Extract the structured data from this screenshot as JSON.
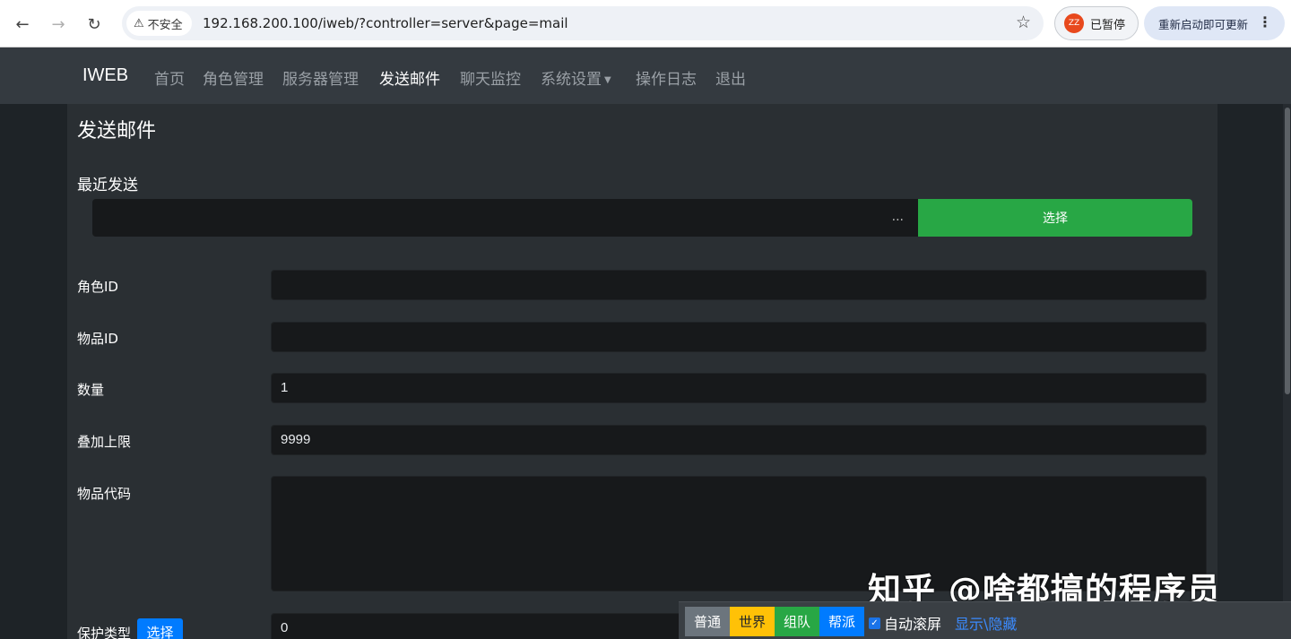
{
  "browser": {
    "security_label": "不安全",
    "url": "192.168.200.100/iweb/?controller=server&page=mail",
    "profile_initials": "ZZ",
    "profile_status": "已暂停",
    "update_label": "重新启动即可更新"
  },
  "navbar": {
    "brand": "IWEB",
    "links": [
      "首页",
      "角色管理",
      "服务器管理",
      "发送邮件",
      "聊天监控",
      "系统设置",
      "操作日志",
      "退出"
    ],
    "active": "发送邮件"
  },
  "page": {
    "title": "发送邮件",
    "recent_label": "最近发送",
    "recent_placeholder": "...",
    "select_button": "选择"
  },
  "form": {
    "role_id_label": "角色ID",
    "role_id_value": "",
    "item_id_label": "物品ID",
    "item_id_value": "",
    "quantity_label": "数量",
    "quantity_value": "1",
    "stack_limit_label": "叠加上限",
    "stack_limit_value": "9999",
    "item_code_label": "物品代码",
    "item_code_value": "",
    "protect_type_label": "保护类型",
    "protect_select_button": "选择",
    "protect_type_value": "0"
  },
  "chat": {
    "channels": [
      "普通",
      "世界",
      "组队",
      "帮派"
    ],
    "autoscroll_label": "自动滚屏",
    "autoscroll_checked": true,
    "toggle_label": "显示\\隐藏"
  },
  "watermark": "知乎 @啥都搞的程序员",
  "colors": {
    "navbar_bg": "#343a40",
    "card_bg": "#2a2f33",
    "input_bg": "#17191b",
    "success": "#28a745",
    "primary": "#007bff",
    "warning": "#ffc107",
    "secondary": "#6c757d"
  }
}
